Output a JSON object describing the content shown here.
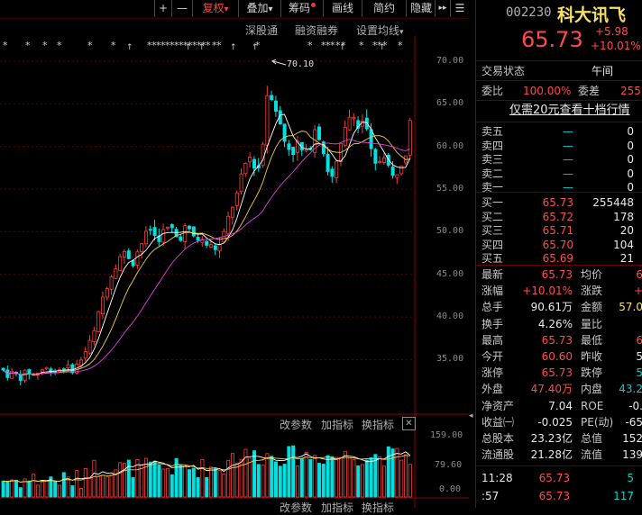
{
  "toolbar": {
    "plus": "+",
    "minus": "—",
    "fuquan": "复权",
    "fuquan_arrow": "▾",
    "diejia": "叠加",
    "diejia_arrow": "▾",
    "chouma": "筹码",
    "huaxian": "画线",
    "jianyue": "简约",
    "yincang": "隐藏",
    "more": "▸▸",
    "menu_icon": "☰"
  },
  "subbar": {
    "shengutong": "深股通",
    "rongzi": "融资融券",
    "junxian": "设置均线",
    "junxian_arrow": "▾"
  },
  "price_axis": [
    "70.00",
    "65.00",
    "60.00",
    "55.00",
    "50.00",
    "45.00",
    "40.00",
    "35.00"
  ],
  "high_marker": "70.10",
  "volume_bar": {
    "gaicanshu": "改参数",
    "jiazhibiao": "加指标",
    "huanzhibiao": "换指标",
    "close": "✕"
  },
  "volume_axis": [
    "159.00",
    "79.60",
    "0.00"
  ],
  "volume_bar2": {
    "gaicanshu": "改参数",
    "jiazhibiao": "加指标",
    "huanzhibiao": "换指标"
  },
  "stock": {
    "code": "002230",
    "name": "科大讯飞",
    "price": "65.73",
    "change": "+5.98",
    "change_pct": "+10.01%"
  },
  "trade_state": {
    "label": "交易状态",
    "value": "午间"
  },
  "ratio": {
    "weibi_label": "委比",
    "weibi_value": "100.00%",
    "weicha_label": "委差",
    "weicha_value": "255"
  },
  "promo": "仅需20元查看十档行情",
  "asks": [
    {
      "label": "卖五",
      "price": "—",
      "vol": "0"
    },
    {
      "label": "卖四",
      "price": "—",
      "vol": "0"
    },
    {
      "label": "卖三",
      "price": "—",
      "vol": "0"
    },
    {
      "label": "卖二",
      "price": "—",
      "vol": "0"
    },
    {
      "label": "卖一",
      "price": "—",
      "vol": "0"
    }
  ],
  "bids": [
    {
      "label": "买一",
      "price": "65.73",
      "vol": "255448"
    },
    {
      "label": "买二",
      "price": "65.72",
      "vol": "178"
    },
    {
      "label": "买三",
      "price": "65.71",
      "vol": "20"
    },
    {
      "label": "买四",
      "price": "65.70",
      "vol": "104"
    },
    {
      "label": "买五",
      "price": "65.69",
      "vol": "21"
    }
  ],
  "stats": [
    {
      "l1": "最新",
      "v1": "65.73",
      "c1": "red",
      "l2": "均价",
      "v2": "6",
      "c2": "red"
    },
    {
      "l1": "涨幅",
      "v1": "+10.01%",
      "c1": "red",
      "l2": "涨跌",
      "v2": "+",
      "c2": "red"
    },
    {
      "l1": "总手",
      "v1": "90.61万",
      "c1": "white",
      "l2": "金额",
      "v2": "57.0",
      "c2": "yellow"
    },
    {
      "l1": "换手",
      "v1": "4.26%",
      "c1": "white",
      "l2": "量比",
      "v2": "",
      "c2": "white"
    },
    {
      "l1": "最高",
      "v1": "65.73",
      "c1": "red",
      "l2": "最低",
      "v2": "6",
      "c2": "red"
    },
    {
      "l1": "今开",
      "v1": "60.60",
      "c1": "red",
      "l2": "昨收",
      "v2": "5",
      "c2": "white"
    },
    {
      "l1": "涨停",
      "v1": "65.73",
      "c1": "red",
      "l2": "跌停",
      "v2": "5",
      "c2": "green"
    },
    {
      "l1": "外盘",
      "v1": "47.40万",
      "c1": "red",
      "l2": "内盘",
      "v2": "43.2",
      "c2": "green"
    },
    {
      "l1": "净资产",
      "v1": "7.04",
      "c1": "white",
      "l2": "ROE",
      "v2": "-0.",
      "c2": "white"
    },
    {
      "l1": "收益㈠",
      "v1": "-0.025",
      "c1": "white",
      "l2": "PE(动)",
      "v2": "-65",
      "c2": "white"
    },
    {
      "l1": "总股本",
      "v1": "23.23亿",
      "c1": "white",
      "l2": "总值",
      "v2": "152",
      "c2": "white"
    },
    {
      "l1": "流通股",
      "v1": "21.28亿",
      "c1": "white",
      "l2": "流值",
      "v2": "139",
      "c2": "white"
    }
  ],
  "ticks": [
    {
      "time": "11:28",
      "price": "65.73",
      "vol": "5"
    },
    {
      "time": ":57",
      "price": "65.73",
      "vol": "117"
    }
  ],
  "colors": {
    "up": "#ff3b3b",
    "down": "#00e0e0",
    "ma5": "#ffffff",
    "ma10": "#f0d040",
    "ma20": "#e040e0"
  }
}
